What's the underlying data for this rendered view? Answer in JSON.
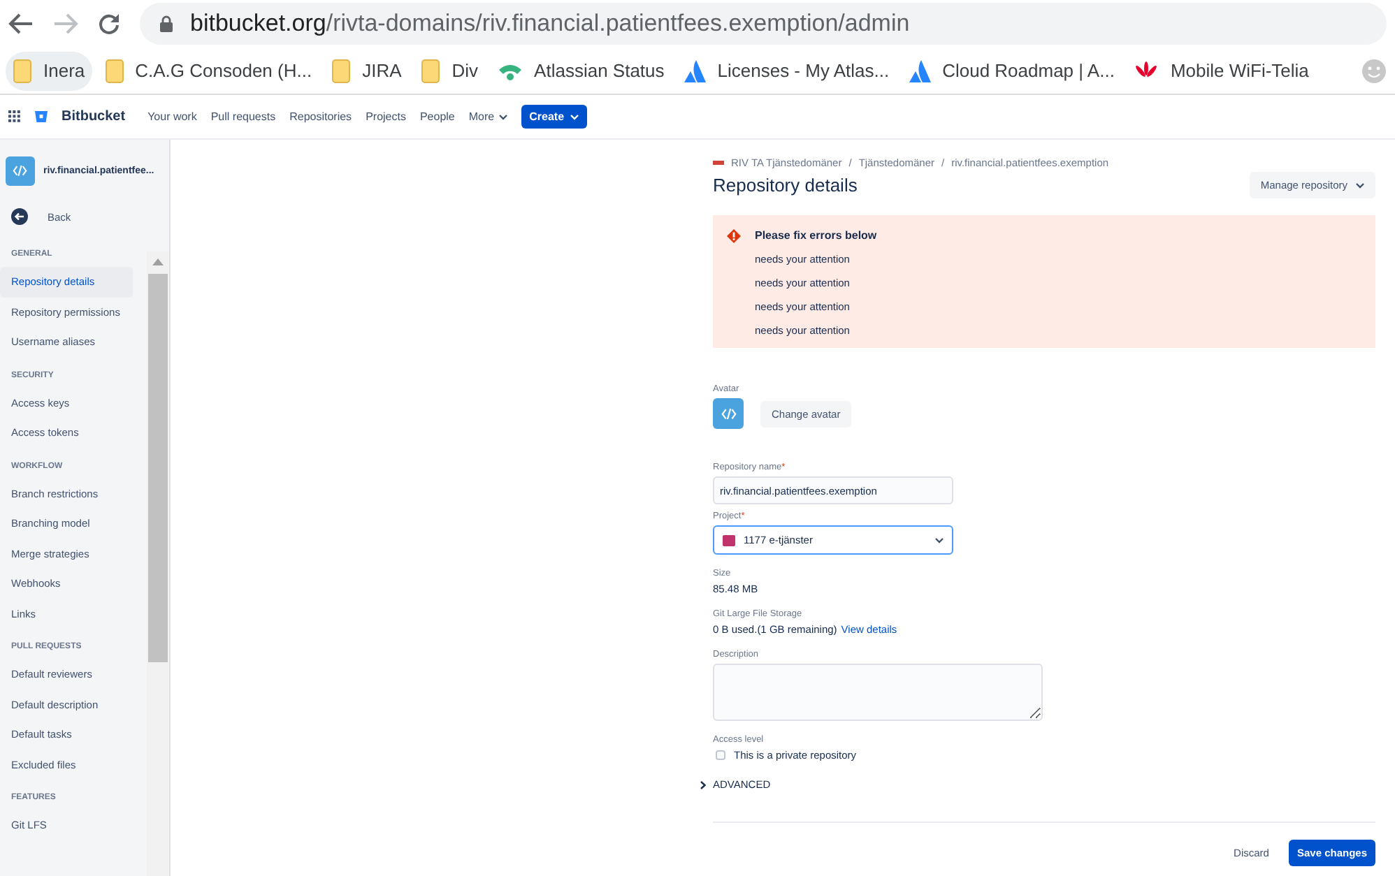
{
  "browser": {
    "url_host": "bitbucket.org",
    "url_path": "/rivta-domains/riv.financial.patientfees.exemption/admin",
    "bookmarks": [
      {
        "label": "Inera",
        "kind": "folder",
        "selected": true
      },
      {
        "label": "C.A.G Consoden (H...",
        "kind": "folder",
        "selected": false
      },
      {
        "label": "JIRA",
        "kind": "folder",
        "selected": false
      },
      {
        "label": "Div",
        "kind": "folder",
        "selected": false
      },
      {
        "label": "Atlassian Status",
        "kind": "signal",
        "selected": false
      },
      {
        "label": "Licenses - My Atlas...",
        "kind": "atlassian",
        "selected": false
      },
      {
        "label": "Cloud Roadmap | A...",
        "kind": "atlassian",
        "selected": false
      },
      {
        "label": "Mobile WiFi-Telia",
        "kind": "flower",
        "selected": false
      }
    ]
  },
  "topnav": {
    "brand": "Bitbucket",
    "items": [
      "Your work",
      "Pull requests",
      "Repositories",
      "Projects",
      "People"
    ],
    "more": "More",
    "create": "Create"
  },
  "sidebar": {
    "repo_name": "riv.financial.patientfee...",
    "back": "Back",
    "sections": [
      {
        "title": "GENERAL",
        "items": [
          {
            "label": "Repository details",
            "selected": true
          },
          {
            "label": "Repository permissions",
            "selected": false
          },
          {
            "label": "Username aliases",
            "selected": false
          }
        ]
      },
      {
        "title": "SECURITY",
        "items": [
          {
            "label": "Access keys",
            "selected": false
          },
          {
            "label": "Access tokens",
            "selected": false
          }
        ]
      },
      {
        "title": "WORKFLOW",
        "items": [
          {
            "label": "Branch restrictions",
            "selected": false
          },
          {
            "label": "Branching model",
            "selected": false
          },
          {
            "label": "Merge strategies",
            "selected": false
          },
          {
            "label": "Webhooks",
            "selected": false
          },
          {
            "label": "Links",
            "selected": false
          }
        ]
      },
      {
        "title": "PULL REQUESTS",
        "items": [
          {
            "label": "Default reviewers",
            "selected": false
          },
          {
            "label": "Default description",
            "selected": false
          },
          {
            "label": "Default tasks",
            "selected": false
          },
          {
            "label": "Excluded files",
            "selected": false
          }
        ]
      },
      {
        "title": "FEATURES",
        "items": [
          {
            "label": "Git LFS",
            "selected": false
          }
        ]
      }
    ]
  },
  "main": {
    "breadcrumb_separator": "/",
    "required_mark": "*",
    "breadcrumbs": [
      "RIV TA Tjänstedomäner",
      "Tjänstedomäner",
      "riv.financial.patientfees.exemption"
    ],
    "title": "Repository details",
    "manage": "Manage repository",
    "alert": {
      "title": "Please fix errors below",
      "messages": [
        "needs your attention",
        "needs your attention",
        "needs your attention",
        "needs your attention"
      ]
    },
    "avatar_label": "Avatar",
    "change_avatar": "Change avatar",
    "repo_name_label": "Repository name",
    "repo_name_value": "riv.financial.patientfees.exemption",
    "project_label": "Project",
    "project_value": "1177 e-tjänster",
    "size_label": "Size",
    "size_value": "85.48 MB",
    "lfs_label": "Git Large File Storage",
    "lfs_value": "0 B used.(1 GB remaining)",
    "lfs_link": "View details",
    "description_label": "Description",
    "access_label": "Access level",
    "private_label": "This is a private repository",
    "private_checked": false,
    "advanced": "ADVANCED",
    "advanced_expanded": false,
    "discard": "Discard",
    "save": "Save changes"
  }
}
